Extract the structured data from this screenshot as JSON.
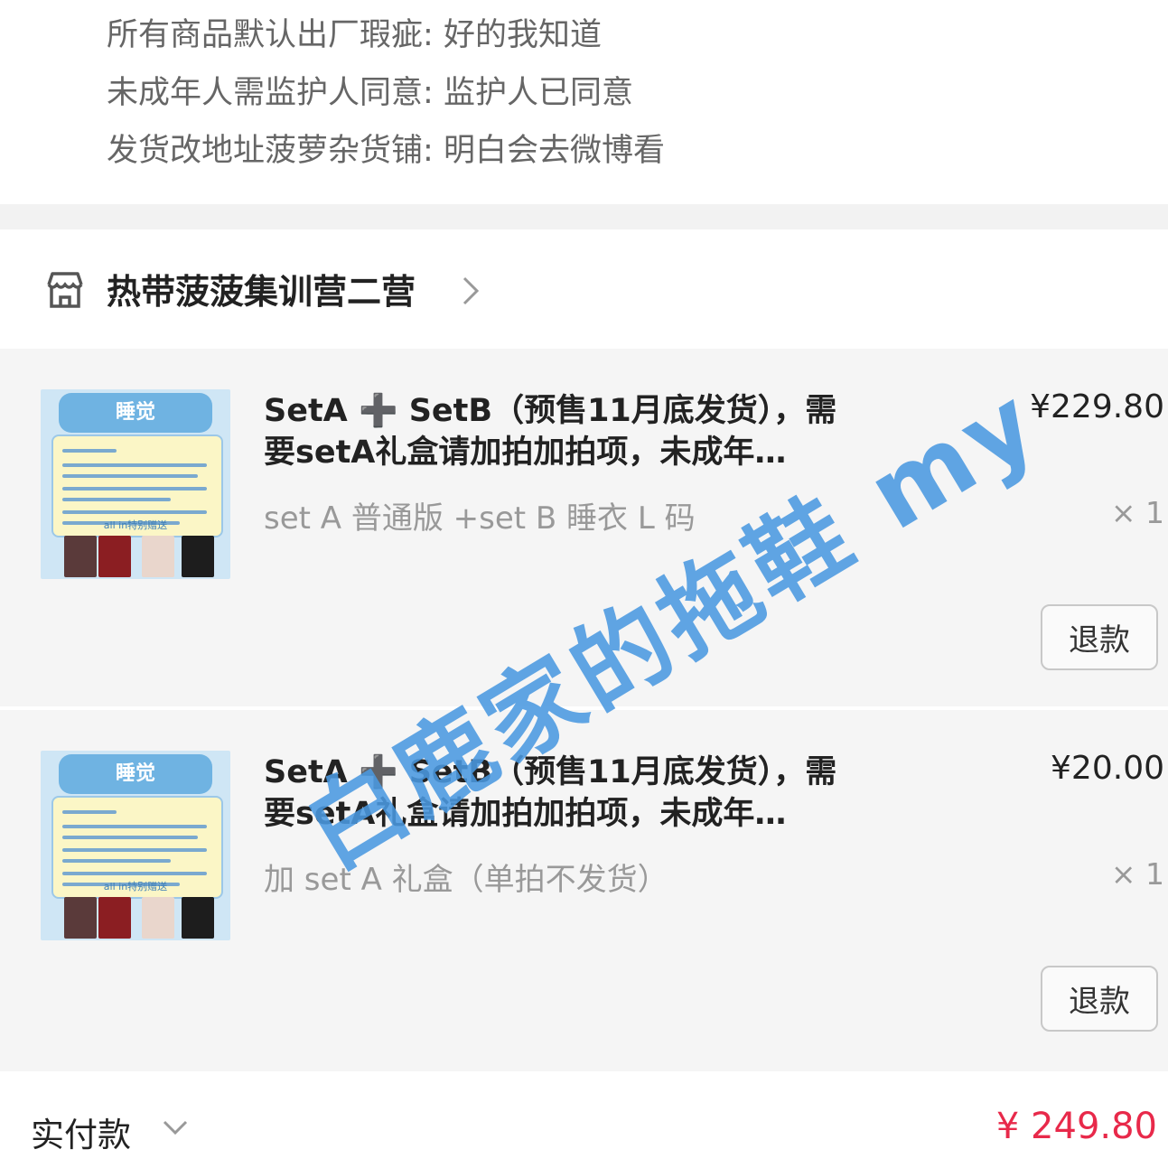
{
  "notes": [
    {
      "label": "所有商品默认出厂瑕疵",
      "value": "好的我知道"
    },
    {
      "label": "未成年人需监护人同意",
      "value": "监护人已同意"
    },
    {
      "label": "发货改地址菠萝杂货铺",
      "value": "明白会去微博看"
    }
  ],
  "shop": {
    "name": "热带菠菠集训营二营",
    "icon": "store-icon"
  },
  "items": [
    {
      "title": "SetA ➕ SetB（预售11月底发货），需要setA礼盒请加拍加拍项，未成年…",
      "spec": "set A 普通版 +set B 睡衣 L 码",
      "price": "¥229.80",
      "qty": "× 1",
      "refund": "退款",
      "thumb_title": "睡觉",
      "thumb_caption": "all in特别赠送"
    },
    {
      "title": "SetA ➕ SetB（预售11月底发货），需要setA礼盒请加拍加拍项，未成年…",
      "spec": "加 set A 礼盒（单拍不发货）",
      "price": "¥20.00",
      "qty": "× 1",
      "refund": "退款",
      "thumb_title": "睡觉",
      "thumb_caption": "all in特别赠送"
    }
  ],
  "total": {
    "label": "实付款",
    "amount": "¥ 249.80"
  },
  "watermark": "白鹿家的拖鞋 my",
  "colors": {
    "accent": "#e8294a",
    "watermark": "#4a98e0"
  }
}
